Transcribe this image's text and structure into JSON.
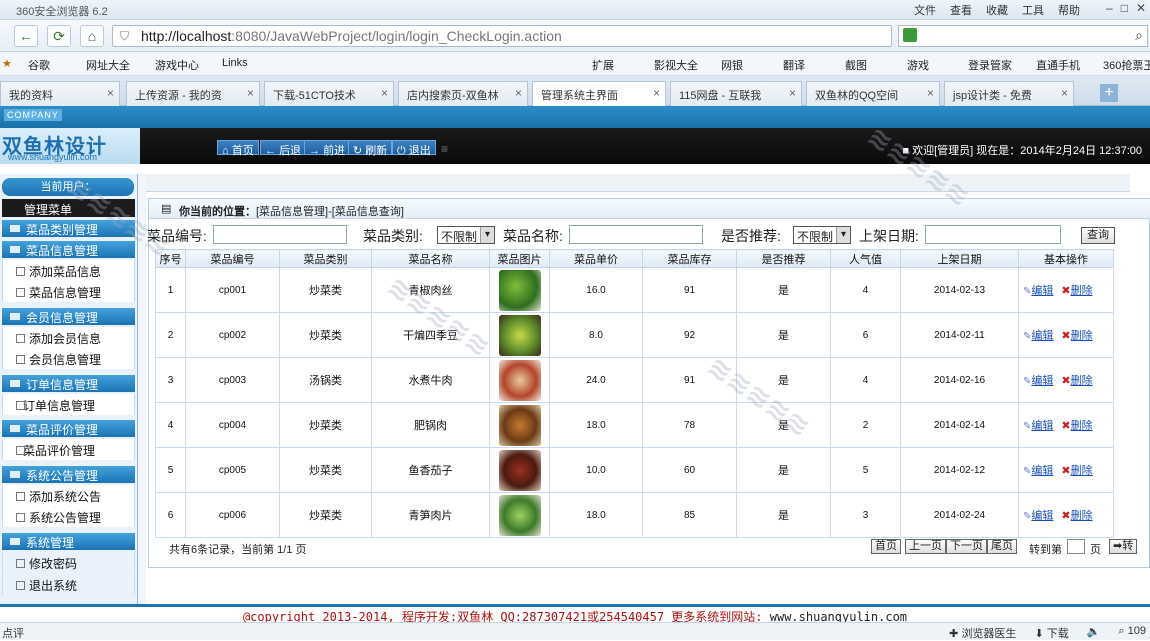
{
  "browser": {
    "title": "360安全浏览器 6.2",
    "menus": [
      "文件",
      "查看",
      "收藏",
      "工具",
      "帮助"
    ],
    "url_host": "http://localhost",
    "url_path": ":8080/JavaWebProject/login/login_CheckLogin.action",
    "favorites": [
      "谷歌",
      "网址大全",
      "游戏中心",
      "Links"
    ],
    "toolbar_right": [
      "扩展",
      "影视大全",
      "网银",
      "翻译",
      "截图",
      "游戏",
      "登录管家",
      "直通手机",
      "360抢票王"
    ],
    "tabs": [
      {
        "label": "我的资料"
      },
      {
        "label": "上传资源 - 我的资"
      },
      {
        "label": "下载-51CTO技术"
      },
      {
        "label": "店内搜索页-双鱼林"
      },
      {
        "label": "管理系统主界面"
      },
      {
        "label": "115网盘 - 互联我"
      },
      {
        "label": "双鱼林的QQ空间"
      },
      {
        "label": "jsp设计类 - 免费"
      }
    ],
    "status_left": "点评",
    "status_right": [
      "浏览器医生",
      "下载",
      "109"
    ]
  },
  "app": {
    "company": "COMPANY",
    "logo_cn": "双鱼林设计",
    "logo_en": "www.shuangyulin.com",
    "nav_buttons": [
      "首页",
      "后退",
      "前进",
      "刷新",
      "退出"
    ],
    "welcome": "欢迎[管理员]  现在是：2014年2月24日 12:37:00",
    "current_user": "当前用户：",
    "menu_title": "管理菜单",
    "sidebar": {
      "g1": "菜品类别管理",
      "g2": "菜品信息管理",
      "g2_items": [
        "添加菜品信息",
        "菜品信息管理"
      ],
      "g3": "会员信息管理",
      "g3_items": [
        "添加会员信息",
        "会员信息管理"
      ],
      "g4": "订单信息管理",
      "g4_items": [
        "订单信息管理"
      ],
      "g5": "菜品评价管理",
      "g5_items": [
        "菜品评价管理"
      ],
      "g6": "系统公告管理",
      "g6_items": [
        "添加系统公告",
        "系统公告管理"
      ],
      "g7": "系统管理",
      "g7_items": [
        "修改密码",
        "退出系统"
      ]
    },
    "breadcrumb_prefix": "你当前的位置：",
    "breadcrumb_path": "[菜品信息管理]-[菜品信息查询]",
    "filters": {
      "code_label": "菜品编号:",
      "type_label": "菜品类别:",
      "type_value": "不限制",
      "name_label": "菜品名称:",
      "recommend_label": "是否推荐:",
      "recommend_value": "不限制",
      "date_label": "上架日期:",
      "query_button": "查询"
    },
    "table": {
      "headers": [
        "序号",
        "菜品编号",
        "菜品类别",
        "菜品名称",
        "菜品图片",
        "菜品单价",
        "菜品库存",
        "是否推荐",
        "人气值",
        "上架日期",
        "基本操作"
      ],
      "rows": [
        {
          "no": "1",
          "code": "cp001",
          "type": "炒菜类",
          "name": "青椒肉丝",
          "price": "16.0",
          "stock": "91",
          "rec": "是",
          "pop": "4",
          "date": "2014-02-13"
        },
        {
          "no": "2",
          "code": "cp002",
          "type": "炒菜类",
          "name": "干煸四季豆",
          "price": "8.0",
          "stock": "92",
          "rec": "是",
          "pop": "6",
          "date": "2014-02-11"
        },
        {
          "no": "3",
          "code": "cp003",
          "type": "汤锅类",
          "name": "水煮牛肉",
          "price": "24.0",
          "stock": "91",
          "rec": "是",
          "pop": "4",
          "date": "2014-02-16"
        },
        {
          "no": "4",
          "code": "cp004",
          "type": "炒菜类",
          "name": "肥锅肉",
          "price": "18.0",
          "stock": "78",
          "rec": "是",
          "pop": "2",
          "date": "2014-02-14"
        },
        {
          "no": "5",
          "code": "cp005",
          "type": "炒菜类",
          "name": "鱼香茄子",
          "price": "10.0",
          "stock": "60",
          "rec": "是",
          "pop": "5",
          "date": "2014-02-12"
        },
        {
          "no": "6",
          "code": "cp006",
          "type": "炒菜类",
          "name": "青笋肉片",
          "price": "18.0",
          "stock": "85",
          "rec": "是",
          "pop": "3",
          "date": "2014-02-24"
        }
      ],
      "edit_label": "编辑",
      "delete_label": "删除"
    },
    "pager": {
      "info": "共有6条记录，当前第 1/1 页",
      "first": "首页",
      "prev": "上一页",
      "next": "下一页",
      "last": "尾页",
      "goto_label": "转到第",
      "page_unit": "页",
      "go": "转"
    },
    "footer_text": "@copyright 2013-2014, 程序开发:双鱼林  QQ:287307421或254540457  更多系统到网站: ",
    "footer_link": "www.shuangyulin.com"
  },
  "colors": {
    "brand_blue": "#1c73b5",
    "header_black": "#0a0a0a",
    "footer_red": "#b01010"
  }
}
